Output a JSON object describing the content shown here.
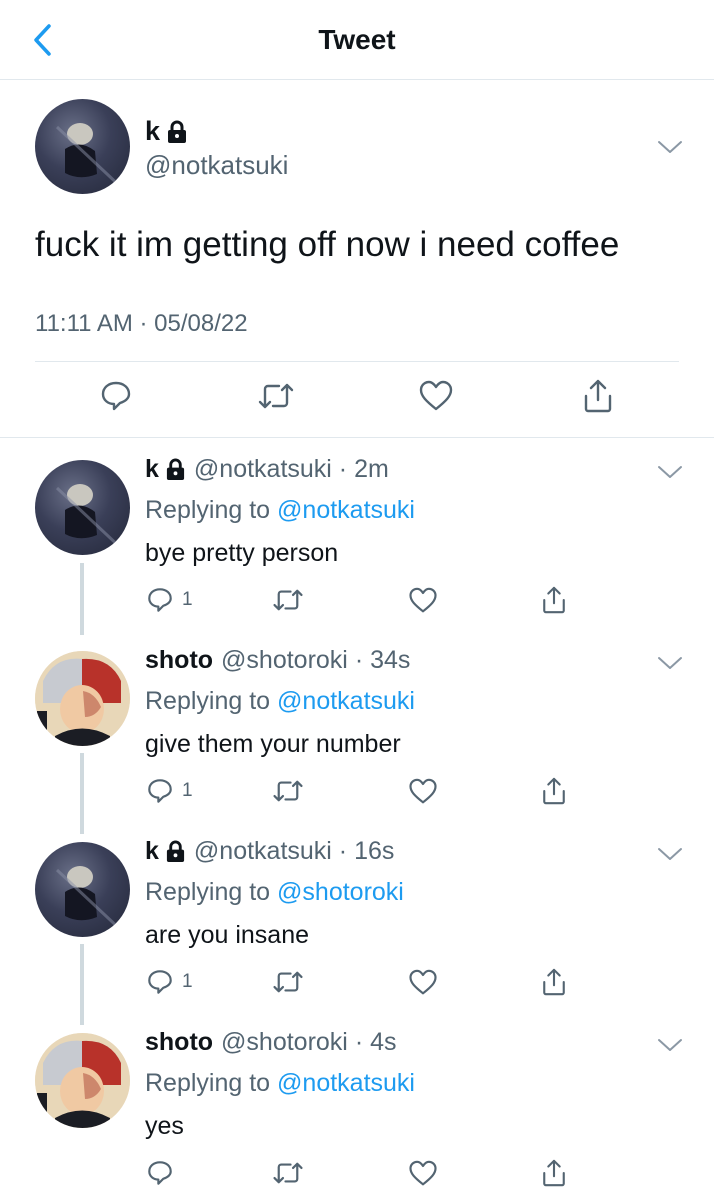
{
  "nav": {
    "title": "Tweet",
    "back_icon": "chevron-left-icon"
  },
  "main_tweet": {
    "name": "k",
    "handle": "@notkatsuki",
    "text": "fuck it im getting off now i need coffee",
    "timestamp": "11:11 AM · 05/08/22",
    "icons": [
      "lock-icon",
      "chevron-down-icon",
      "reply-icon",
      "retweet-icon",
      "like-icon",
      "share-icon"
    ]
  },
  "replies": [
    {
      "name": "k",
      "handle": "@notkatsuki",
      "time": "2m",
      "replying_label": "Replying to ",
      "replying_to": "@notkatsuki",
      "text": "bye pretty person",
      "reply_count": "1"
    },
    {
      "name": "shoto",
      "handle": "@shotoroki",
      "time": "34s",
      "replying_label": "Replying to ",
      "replying_to": "@notkatsuki",
      "text": "give them your number",
      "reply_count": "1"
    },
    {
      "name": "k",
      "handle": "@notkatsuki",
      "time": "16s",
      "replying_label": "Replying to ",
      "replying_to": "@shotoroki",
      "text": "are you insane",
      "reply_count": "1"
    },
    {
      "name": "shoto",
      "handle": "@shotoroki",
      "time": "4s",
      "replying_label": "Replying to ",
      "replying_to": "@notkatsuki",
      "text": "yes",
      "reply_count": ""
    }
  ],
  "colors": {
    "accent": "#1d9bf0",
    "secondary_text": "#536471",
    "divider": "#e1e8ed",
    "thread_line": "#cfd9de"
  }
}
